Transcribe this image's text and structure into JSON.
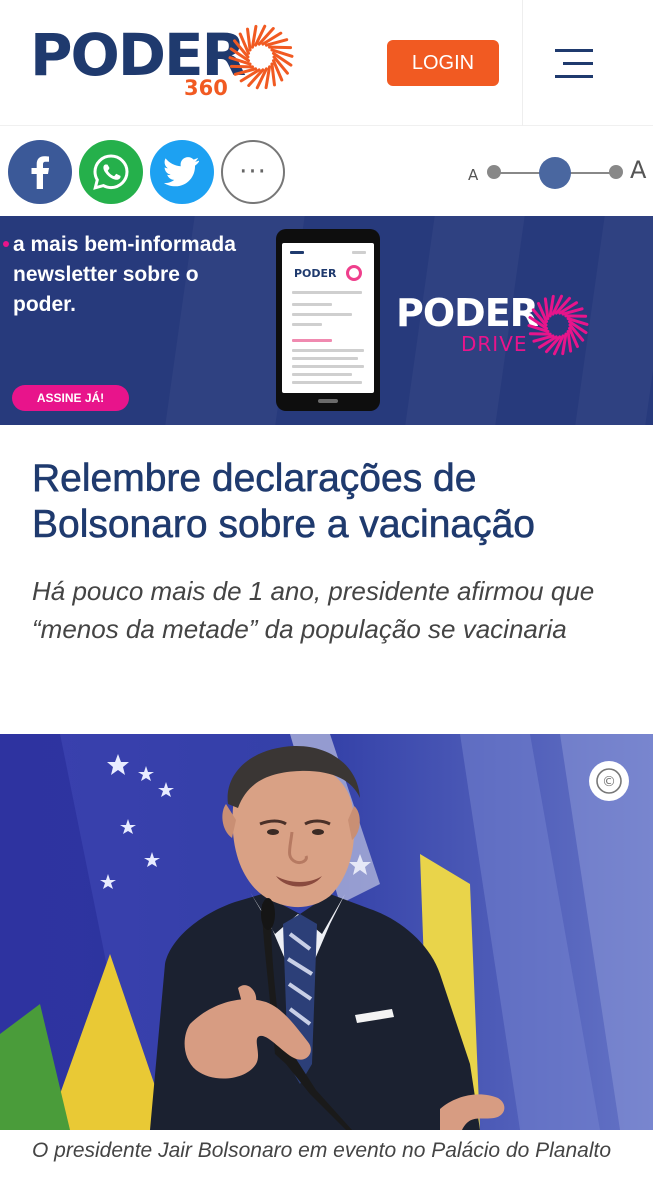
{
  "colors": {
    "brand_blue": "#1f3a6e",
    "brand_orange": "#f15a22",
    "facebook": "#3b5998",
    "whatsapp": "#25b04b",
    "twitter": "#1da1f2",
    "slider_knob": "#4a67a0",
    "banner_bg": "#273a7c",
    "banner_pink": "#e8148b",
    "headline": "#1f3a6e"
  },
  "header": {
    "logo_word": "PODER",
    "logo_number": "360",
    "login_label": "LOGIN",
    "menu_icon": "hamburger-menu-icon"
  },
  "share": {
    "buttons": [
      {
        "name": "facebook",
        "icon": "facebook-icon"
      },
      {
        "name": "whatsapp",
        "icon": "whatsapp-icon"
      },
      {
        "name": "twitter",
        "icon": "twitter-icon"
      },
      {
        "name": "more",
        "icon": "more-icon",
        "label": "···"
      }
    ],
    "font_size_small_label": "A",
    "font_size_large_label": "A",
    "font_size_level": "medium"
  },
  "banner": {
    "text": "a mais bem-informada newsletter sobre o poder.",
    "cta": "ASSINE JÁ!",
    "brand_word": "PODER",
    "brand_sub": "DRIVE"
  },
  "article": {
    "headline": "Relembre declarações de Bolsonaro sobre a vacinação",
    "subhead": "Há pouco mais de 1 ano, presidente afirmou que “menos da metade” da população se vacinaria"
  },
  "photo": {
    "copyright_symbol": "©",
    "caption": "O presidente Jair Bolsonaro em evento no Palácio do Planalto"
  }
}
